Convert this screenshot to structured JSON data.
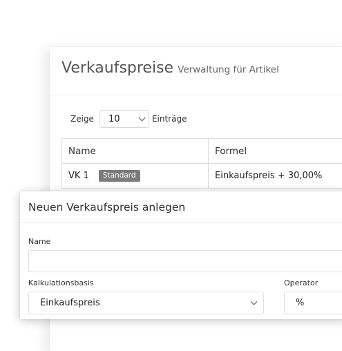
{
  "page": {
    "title": "Verkaufspreise",
    "subtitle": "Verwaltung für Artikel"
  },
  "length_menu": {
    "prefix": "Zeige",
    "value": "10",
    "suffix": "Einträge"
  },
  "table": {
    "columns": [
      "Name",
      "Formel"
    ],
    "rows": [
      {
        "name": "VK 1",
        "badge": "Standard",
        "formula": "Einkaufspreis + 30,00%"
      }
    ]
  },
  "modal": {
    "title": "Neuen Verkaufspreis anlegen",
    "name_label": "Name",
    "name_value": "",
    "basis_label": "Kalkulationsbasis",
    "basis_value": "Einkaufspreis",
    "operator_label": "Operator",
    "operator_value": "%"
  },
  "colors": {
    "badge_bg": "#7b7b7b",
    "border": "#dcdcdc"
  }
}
